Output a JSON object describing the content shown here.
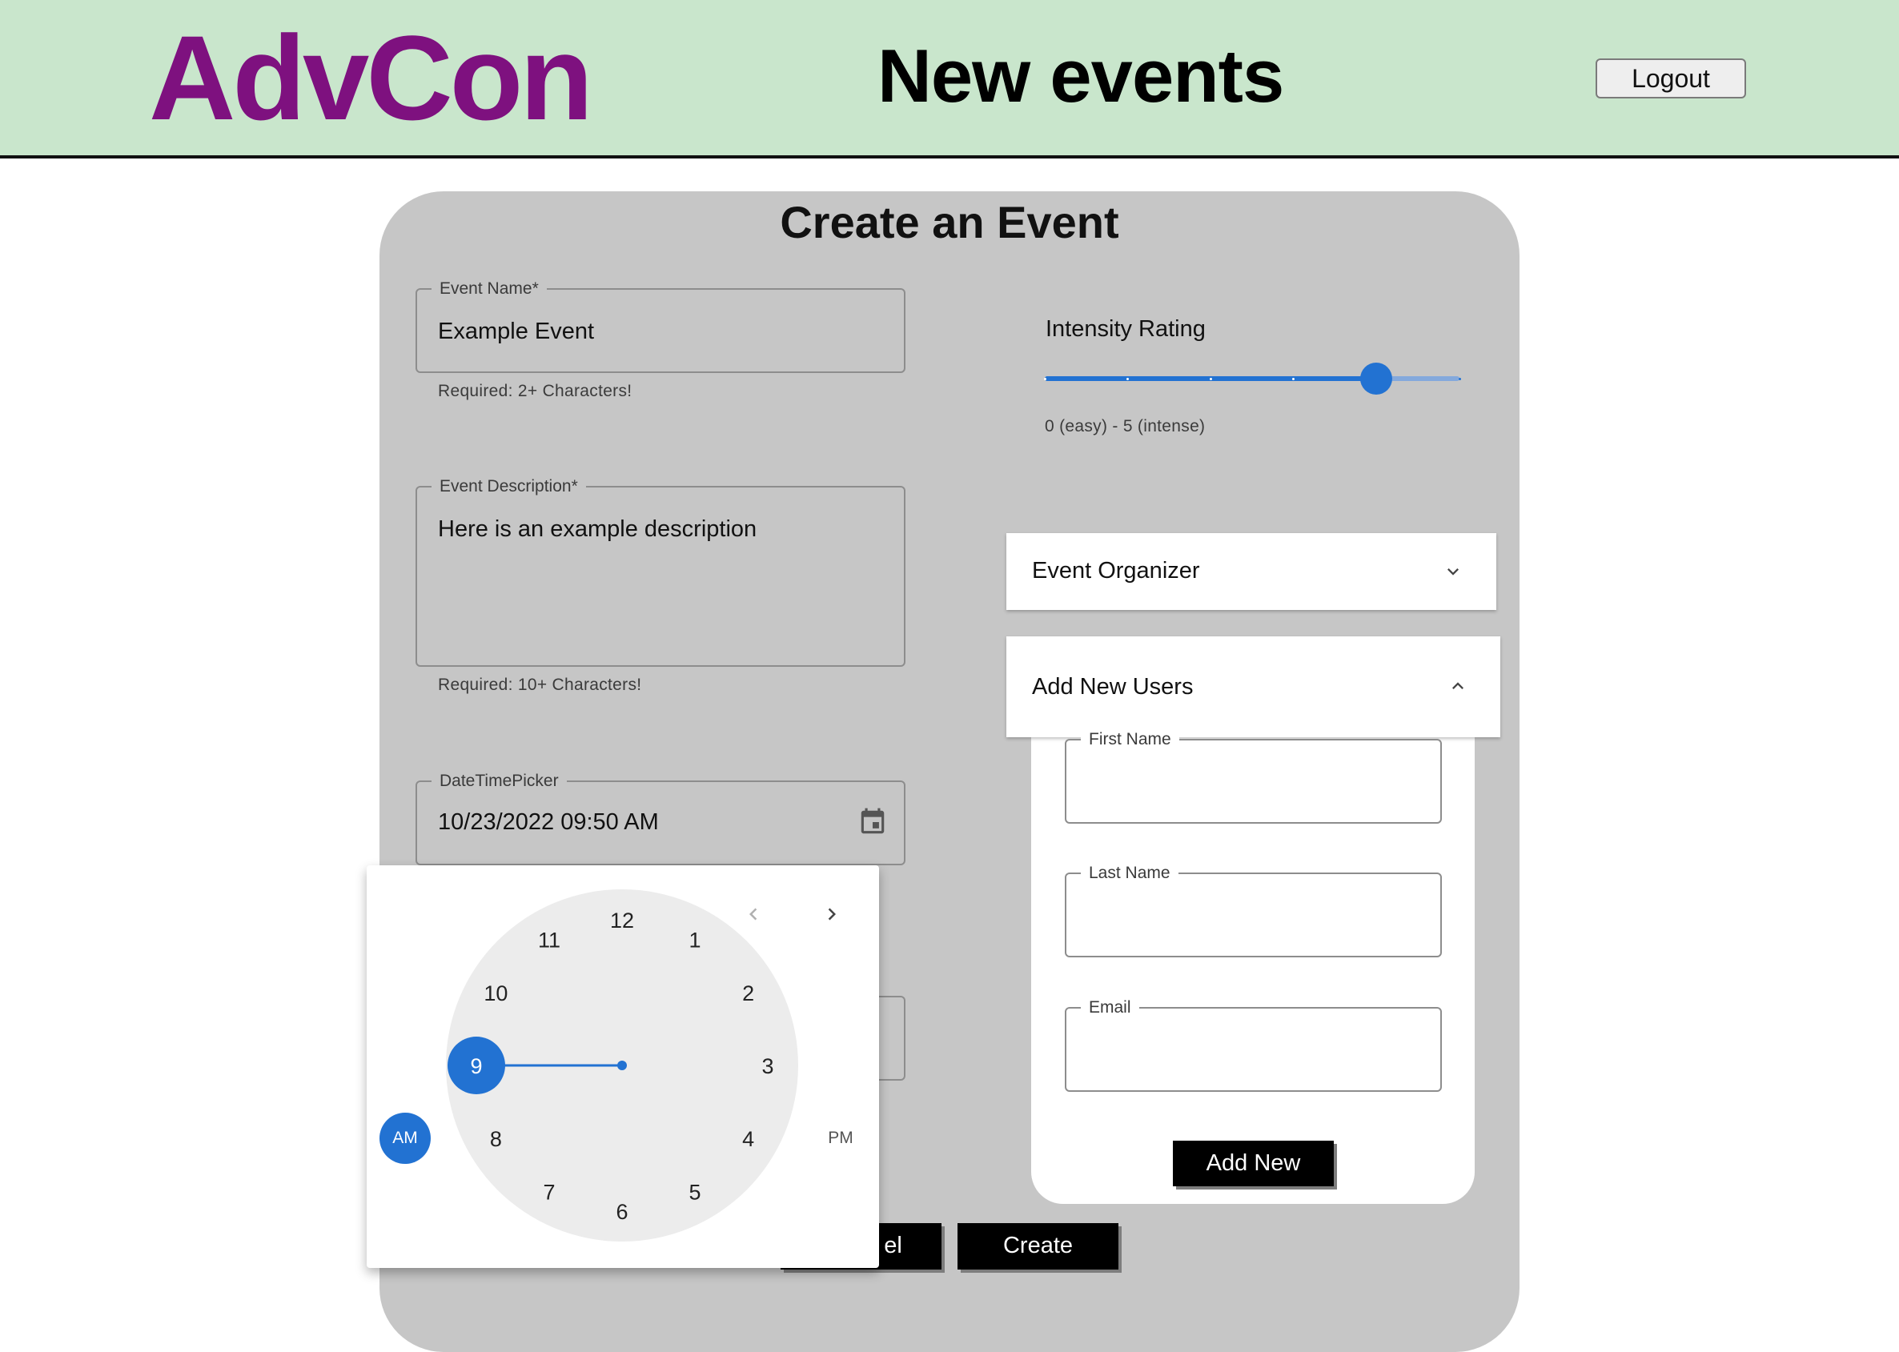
{
  "header": {
    "brand": "AdvCon",
    "title": "New events",
    "logout_label": "Logout"
  },
  "form": {
    "title": "Create an Event",
    "event_name": {
      "label": "Event Name",
      "required_mark": "*",
      "value": "Example Event",
      "helper": "Required: 2+ Characters!"
    },
    "event_description": {
      "label": "Event Description",
      "required_mark": "*",
      "value": "Here is an example description",
      "helper": "Required: 10+ Characters!"
    },
    "datetime": {
      "label": "DateTimePicker",
      "value": "10/23/2022 09:50 AM",
      "icon": "calendar-icon"
    },
    "intensity": {
      "label": "Intensity Rating",
      "value": 4,
      "min": 0,
      "max": 5,
      "helper": "0 (easy) - 5 (intense)"
    },
    "organizer": {
      "label": "Event Organizer",
      "icon": "chevron-down-icon"
    },
    "add_users": {
      "label": "Add New Users",
      "icon": "chevron-up-icon",
      "first_name_label": "First Name",
      "last_name_label": "Last Name",
      "email_label": "Email",
      "add_button": "Add New"
    },
    "cancel_label_visible": "el",
    "create_label": "Create"
  },
  "clock": {
    "hours": [
      "12",
      "1",
      "2",
      "3",
      "4",
      "5",
      "6",
      "7",
      "8",
      "9",
      "10",
      "11"
    ],
    "selected_hour": 9,
    "am_label": "AM",
    "pm_label": "PM",
    "selected_period": "AM",
    "prev_icon": "chevron-left-icon",
    "next_icon": "chevron-right-icon"
  },
  "colors": {
    "header_bg": "#c9e6cc",
    "brand": "#7e117f",
    "panel_bg": "#c6c6c6",
    "accent": "#2272d2"
  }
}
